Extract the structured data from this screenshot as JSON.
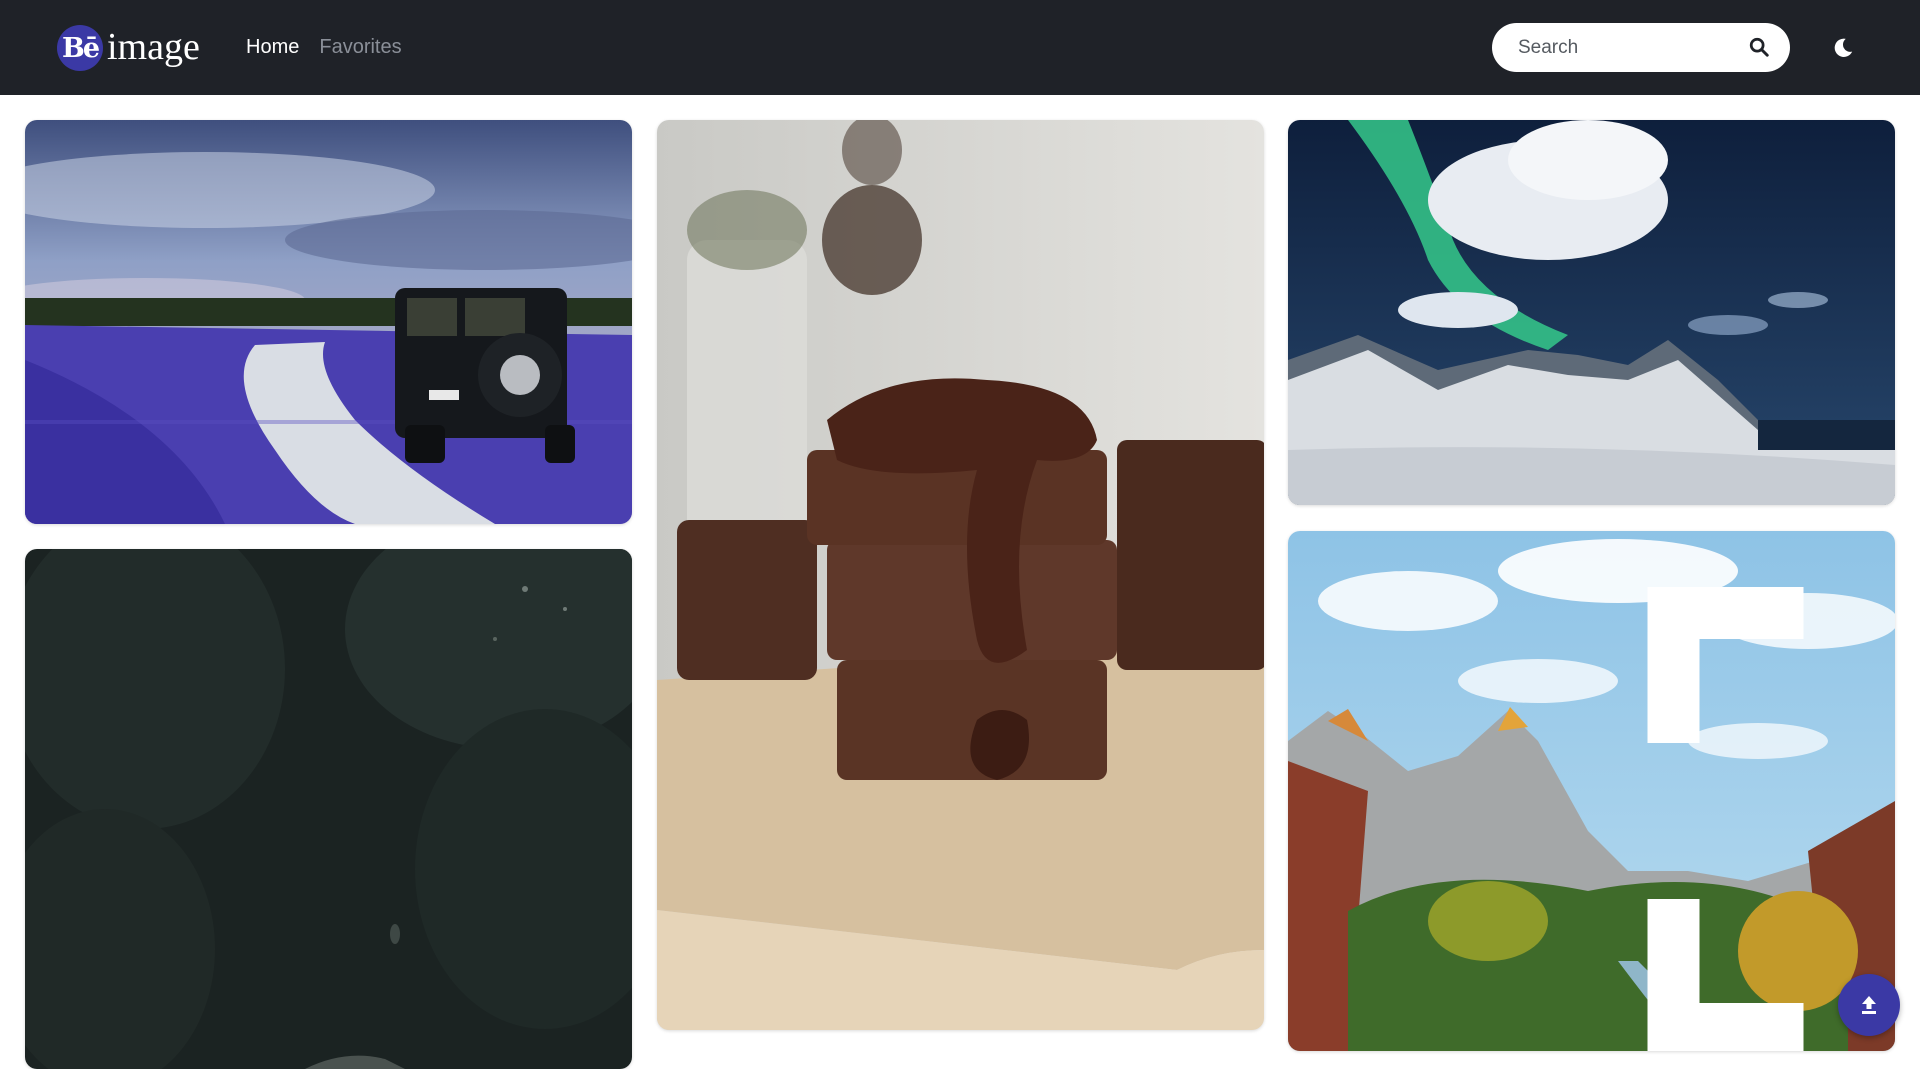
{
  "header": {
    "logo_badge": "Bē",
    "logo_text": "image",
    "nav": [
      {
        "label": "Home",
        "active": true
      },
      {
        "label": "Favorites",
        "active": false
      }
    ],
    "search": {
      "placeholder": "Search",
      "value": ""
    },
    "icons": {
      "search": "search-icon",
      "theme": "moon-icon"
    }
  },
  "gallery": {
    "images": [
      {
        "subject": "jeep-lavender-road",
        "column": 1
      },
      {
        "subject": "dark-forest",
        "column": 1
      },
      {
        "subject": "chocolate-brownies",
        "column": 2
      },
      {
        "subject": "aurora-snowy-mountains",
        "column": 3
      },
      {
        "subject": "zion-canyon",
        "column": 3,
        "overlay_icon": "expand-icon"
      }
    ]
  },
  "fab": {
    "icon": "upload-icon"
  },
  "colors": {
    "header_bg": "#1f2228",
    "accent": "#3b39a5",
    "nav_active": "#ffffff",
    "nav_inactive": "#8a8f98",
    "page_bg": "#ffffff"
  }
}
